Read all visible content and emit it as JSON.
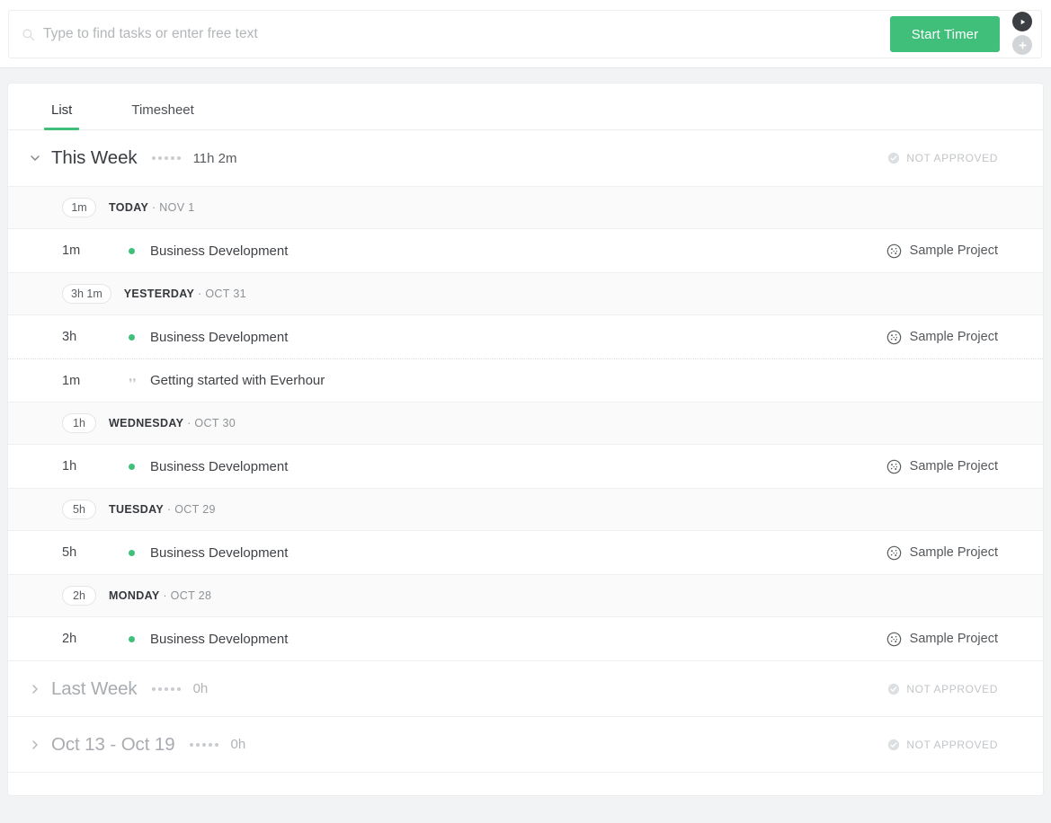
{
  "topbar": {
    "search_placeholder": "Type to find tasks or enter free text",
    "search_value": "",
    "search_icon": "search-icon",
    "start_timer_label": "Start Timer",
    "play_icon": "play-icon",
    "plus_icon": "plus-icon",
    "accent_green": "#3fbf79"
  },
  "tabs": [
    {
      "label": "List",
      "active": true
    },
    {
      "label": "Timesheet",
      "active": false
    }
  ],
  "groups": [
    {
      "title": "This Week",
      "total": "11h 2m",
      "expanded": true,
      "approval": "NOT APPROVED",
      "days": [
        {
          "total": "1m",
          "day_name": "TODAY",
          "date": "· NOV 1",
          "entries": [
            {
              "duration": "1m",
              "marker": "dot",
              "name": "Business Development",
              "project": "Sample Project"
            }
          ]
        },
        {
          "total": "3h 1m",
          "day_name": "YESTERDAY",
          "date": "· OCT 31",
          "entries": [
            {
              "duration": "3h",
              "marker": "dot",
              "name": "Business Development",
              "project": "Sample Project"
            },
            {
              "duration": "1m",
              "marker": "quote",
              "name": "Getting started with Everhour",
              "project": ""
            }
          ]
        },
        {
          "total": "1h",
          "day_name": "WEDNESDAY",
          "date": "· OCT 30",
          "entries": [
            {
              "duration": "1h",
              "marker": "dot",
              "name": "Business Development",
              "project": "Sample Project"
            }
          ]
        },
        {
          "total": "5h",
          "day_name": "TUESDAY",
          "date": "· OCT 29",
          "entries": [
            {
              "duration": "5h",
              "marker": "dot",
              "name": "Business Development",
              "project": "Sample Project"
            }
          ]
        },
        {
          "total": "2h",
          "day_name": "MONDAY",
          "date": "· OCT 28",
          "entries": [
            {
              "duration": "2h",
              "marker": "dot",
              "name": "Business Development",
              "project": "Sample Project"
            }
          ]
        }
      ]
    },
    {
      "title": "Last Week",
      "total": "0h",
      "expanded": false,
      "approval": "NOT APPROVED",
      "days": []
    },
    {
      "title": "Oct 13 - Oct 19",
      "total": "0h",
      "expanded": false,
      "approval": "NOT APPROVED",
      "days": []
    }
  ]
}
